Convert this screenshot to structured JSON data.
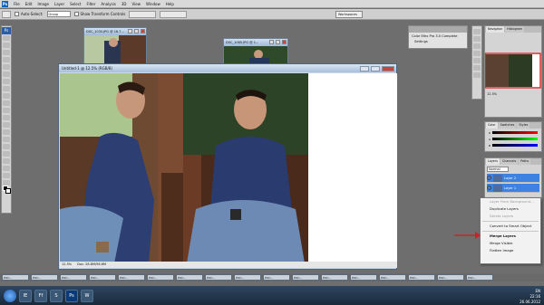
{
  "menubar": {
    "logo": "Ps",
    "items": [
      "File",
      "Edit",
      "Image",
      "Layer",
      "Select",
      "Filter",
      "Analysis",
      "3D",
      "View",
      "Window",
      "Help"
    ]
  },
  "optionsbar": {
    "auto_select_label": "Auto-Select:",
    "auto_select_value": "Group",
    "show_transform_label": "Show Transform Controls",
    "workspace_label": "Workspaces"
  },
  "mini_windows": [
    {
      "title": "DSC_1030.JPG @ 16.7..."
    },
    {
      "title": "DSC_1065.JPG @ 1..."
    }
  ],
  "color_efex": {
    "title": "Color Efex Pro 3.0 Complete",
    "item": "Settings"
  },
  "doc": {
    "title": "Untitled-1 @ 12.5% (RGB/8)",
    "zoom": "12.5%",
    "doc_info": "Doc: 28.8M/56.6M"
  },
  "navigator": {
    "tabs": [
      "Navigator",
      "Histogram"
    ],
    "zoom": "12.5%"
  },
  "color_panel": {
    "tabs": [
      "Color",
      "Swatches",
      "Styles"
    ],
    "channels": [
      {
        "label": "R",
        "value": ""
      },
      {
        "label": "G",
        "value": ""
      },
      {
        "label": "B",
        "value": ""
      }
    ]
  },
  "layers_panel": {
    "tabs": [
      "Layers",
      "Channels",
      "Paths"
    ],
    "blend_mode": "Normal",
    "layers": [
      {
        "name": "Layer 2",
        "selected": true
      },
      {
        "name": "Layer 1",
        "selected": true
      }
    ]
  },
  "context_menu": {
    "items": [
      {
        "label": "Layer From Background...",
        "disabled": true
      },
      {
        "label": "Duplicate Layers",
        "disabled": false
      },
      {
        "label": "Delete Layers",
        "disabled": true
      },
      {
        "sep": true
      },
      {
        "label": "Convert to Smart Object",
        "disabled": false
      },
      {
        "sep": true
      },
      {
        "label": "Merge Layers",
        "disabled": false,
        "highlight": true
      },
      {
        "label": "Merge Visible",
        "disabled": false
      },
      {
        "label": "Flatten Image",
        "disabled": false
      }
    ]
  },
  "filmstrip": [
    "DSC...",
    "DSC...",
    "DSC...",
    "DSC...",
    "DSC...",
    "DSC...",
    "DSC...",
    "DSC...",
    "DSC...",
    "DSC...",
    "DSC...",
    "DSC...",
    "DSC...",
    "DSC...",
    "DSC...",
    "DSC...",
    "DSC..."
  ],
  "taskbar": {
    "apps": [
      "IE",
      "Ff",
      "S",
      "Ps",
      "W"
    ],
    "lang": "EN",
    "time": "22:16",
    "date": "26.06.2012"
  },
  "colors": {
    "accent": "#c8232c",
    "selection": "#3d82e0"
  }
}
